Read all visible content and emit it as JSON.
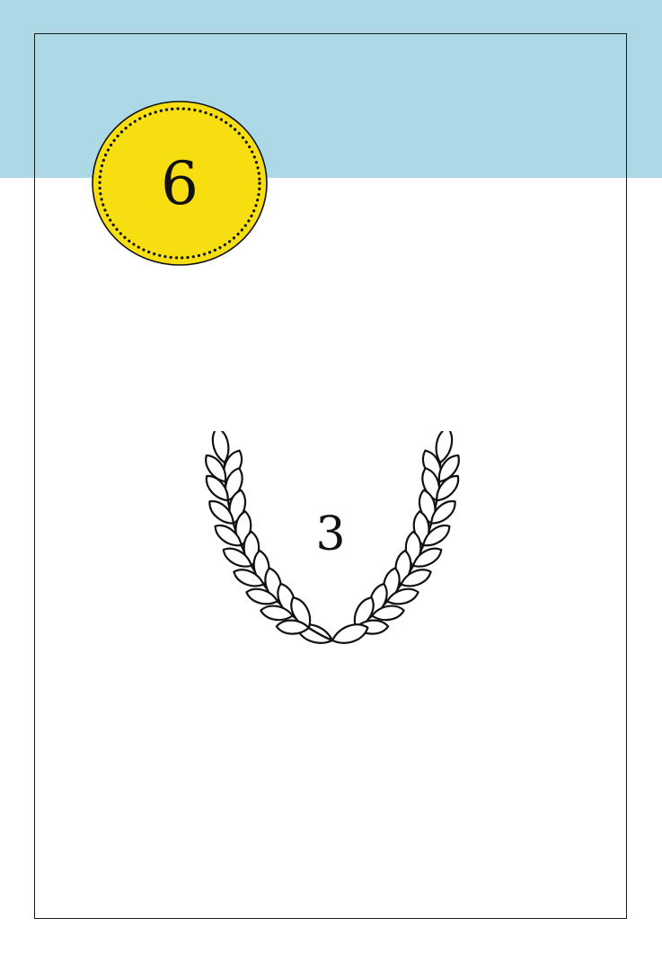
{
  "card": {
    "cost_value": "6",
    "points_value": "3"
  },
  "colors": {
    "band": "#add8e6",
    "coin_fill": "#f6de10",
    "outline": "#111111",
    "background": "#ffffff"
  },
  "icons": {
    "cost": "coin-icon",
    "points": "laurel-wreath-icon"
  }
}
